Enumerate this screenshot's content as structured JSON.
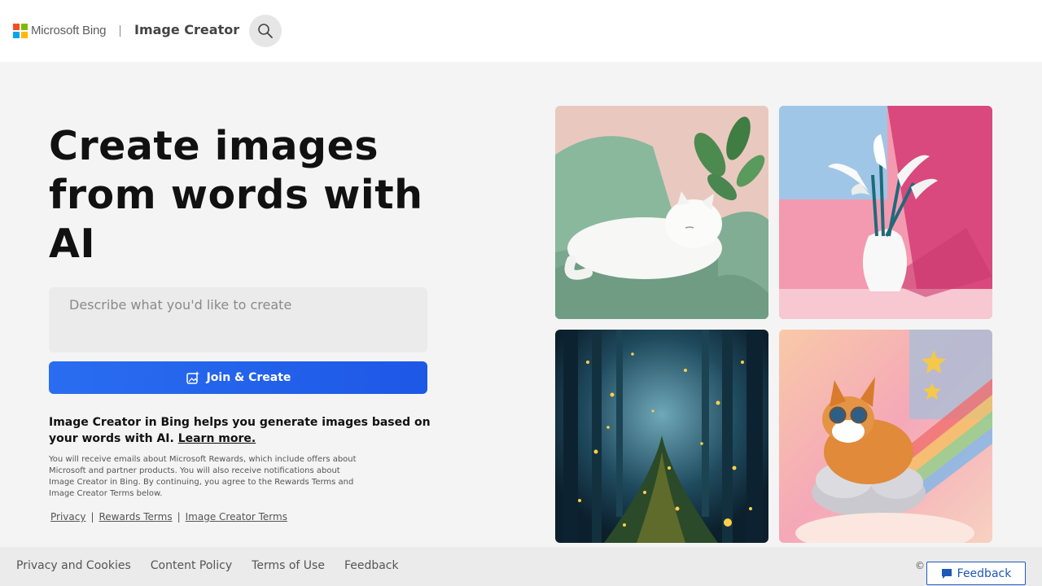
{
  "header": {
    "brand": "Microsoft Bing",
    "product": "Image Creator",
    "search_icon": "search-icon",
    "logo_colors": [
      "#f25022",
      "#7fba00",
      "#00a4ef",
      "#ffb900"
    ]
  },
  "hero": {
    "title": "Create images from words with AI",
    "prompt_placeholder": "Describe what you'd like to create",
    "prompt_value": "",
    "join_label": "Join & Create",
    "join_icon": "image-sparkle-icon",
    "description": "Image Creator in Bing helps you generate images based on your words with AI.",
    "learn_more": "Learn more.",
    "fine_print": "You will receive emails about Microsoft Rewards, which include offers about Microsoft and partner products. You will also receive notifications about Image Creator in Bing. By continuing, you agree to the Rewards Terms and Image Creator Terms below.",
    "links": [
      "Privacy",
      "Rewards Terms",
      "Image Creator Terms"
    ],
    "link_separator": "|",
    "accent_color": "#1d58e6"
  },
  "gallery": {
    "tiles": [
      {
        "subject": "cat-sleeping-on-green-sofa"
      },
      {
        "subject": "calla-lilies-in-white-vase"
      },
      {
        "subject": "glowing-firefly-forest"
      },
      {
        "subject": "corgi-with-goggles-on-cloud"
      }
    ]
  },
  "footer": {
    "links": [
      "Privacy and Cookies",
      "Content Policy",
      "Terms of Use",
      "Feedback"
    ],
    "copyright": "©",
    "feedback_button": "Feedback",
    "feedback_icon": "chat-bubble-icon"
  }
}
